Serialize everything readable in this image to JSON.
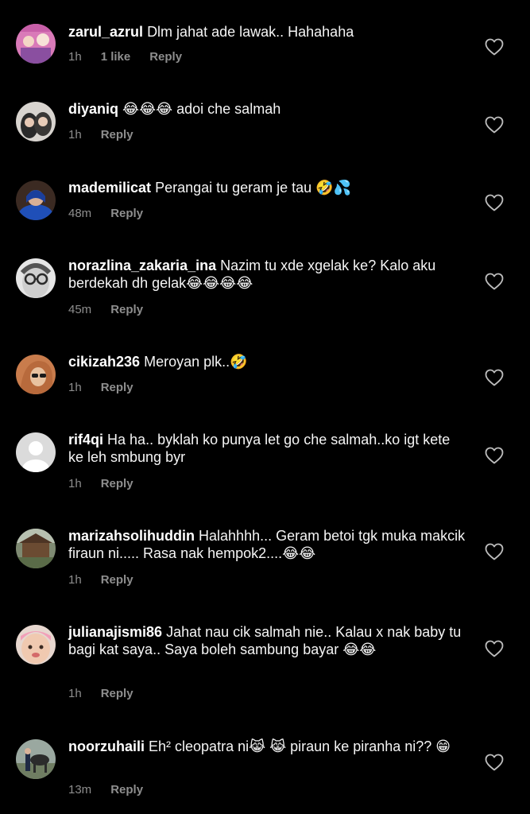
{
  "colors": {
    "background": "#000000",
    "text": "#ffffff",
    "secondary": "#8e8e8e"
  },
  "comments": [
    {
      "username": "zarul_azrul",
      "text": "Dlm jahat ade lawak.. Hahahaha",
      "time": "1h",
      "likes": "1 like",
      "reply": "Reply",
      "avatar_icon": "avatar-photo"
    },
    {
      "username": "diyaniq",
      "text": "😂😂😂 adoi che salmah",
      "time": "1h",
      "reply": "Reply",
      "avatar_icon": "avatar-photo"
    },
    {
      "username": "mademilicat",
      "text": "Perangai tu geram je tau 🤣💦",
      "time": "48m",
      "reply": "Reply",
      "avatar_icon": "avatar-photo"
    },
    {
      "username": "norazlina_zakaria_ina",
      "text": "Nazim tu xde xgelak ke? Kalo aku berdekah dh gelak😂😂😂😂",
      "time": "45m",
      "reply": "Reply",
      "avatar_icon": "avatar-photo"
    },
    {
      "username": "cikizah236",
      "text": "Meroyan plk..🤣",
      "time": "1h",
      "reply": "Reply",
      "avatar_icon": "avatar-photo"
    },
    {
      "username": "rif4qi",
      "text": "Ha ha.. byklah ko punya let go che salmah..ko igt kete ke leh smbung byr",
      "time": "1h",
      "reply": "Reply",
      "avatar_icon": "default-avatar-icon"
    },
    {
      "username": "marizahsolihuddin",
      "text": "Halahhhh... Geram betoi tgk muka makcik firaun ni..... Rasa nak hempok2....😂😂",
      "time": "1h",
      "reply": "Reply",
      "avatar_icon": "avatar-photo"
    },
    {
      "username": "julianajismi86",
      "text": "Jahat nau cik salmah nie.. Kalau x nak baby tu bagi kat saya.. Saya boleh sambung bayar 😂😂",
      "time": "1h",
      "reply": "Reply",
      "avatar_icon": "avatar-photo"
    },
    {
      "username": "noorzuhaili",
      "text": "Eh² cleopatra ni😹 😹 piraun ke piranha ni?? 😁",
      "time": "13m",
      "reply": "Reply",
      "avatar_icon": "avatar-photo"
    }
  ]
}
